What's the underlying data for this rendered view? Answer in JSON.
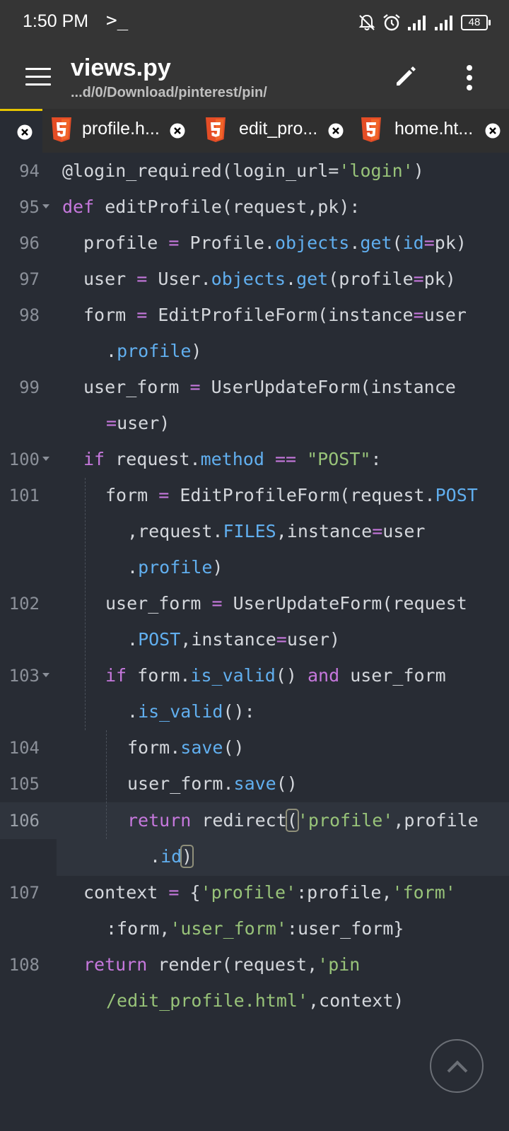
{
  "status_bar": {
    "time": "1:50 PM",
    "terminal_glyph": ">_",
    "battery": "48"
  },
  "app_bar": {
    "title": "views.py",
    "path": "...d/0/Download/pinterest/pin/"
  },
  "tabs": [
    {
      "label": "profile.h...",
      "active": false
    },
    {
      "label": "edit_pro...",
      "active": false
    },
    {
      "label": "home.ht...",
      "active": false
    }
  ],
  "editor": {
    "lines": [
      {
        "num": "94"
      },
      {
        "num": "95"
      },
      {
        "num": "96"
      },
      {
        "num": "97"
      },
      {
        "num": "98"
      },
      {
        "num": "99"
      },
      {
        "num": "100"
      },
      {
        "num": "101"
      },
      {
        "num": "102"
      },
      {
        "num": "103"
      },
      {
        "num": "104"
      },
      {
        "num": "105"
      },
      {
        "num": "106"
      },
      {
        "num": "107"
      },
      {
        "num": "108"
      }
    ],
    "code": {
      "l94_a": "@login_required(login_url=",
      "l94_b": "'login'",
      "l94_c": ")",
      "l95_def": "def",
      "l95_rest": " editProfile(request,pk):",
      "l96_a": "profile ",
      "l96_eq": "=",
      "l96_b": " Profile.",
      "l96_c": "objects",
      "l96_d": ".",
      "l96_e": "get",
      "l96_f": "(",
      "l96_g": "id",
      "l96_h": "=",
      "l96_i": "pk)",
      "l97_a": "user ",
      "l97_eq": "=",
      "l97_b": " User.",
      "l97_c": "objects",
      "l97_d": ".",
      "l97_e": "get",
      "l97_f": "(profile",
      "l97_g": "=",
      "l97_h": "pk)",
      "l98_a": "form ",
      "l98_eq": "=",
      "l98_b": " EditProfileForm(instance",
      "l98_c": "=",
      "l98_d": "user",
      "l98w_a": ".",
      "l98w_b": "profile",
      "l98w_c": ")",
      "l99_a": "user_form ",
      "l99_eq": "=",
      "l99_b": " UserUpdateForm(instance",
      "l99w_a": "=",
      "l99w_b": "user)",
      "l100_if": "if",
      "l100_a": " request.",
      "l100_b": "method",
      "l100_c": " ",
      "l100_d": "==",
      "l100_e": " ",
      "l100_f": "\"POST\"",
      "l100_g": ":",
      "l101_a": "form ",
      "l101_eq": "=",
      "l101_b": " EditProfileForm(request.",
      "l101_c": "POST",
      "l101w1_a": ",request.",
      "l101w1_b": "FILES",
      "l101w1_c": ",instance",
      "l101w1_d": "=",
      "l101w1_e": "user",
      "l101w2_a": ".",
      "l101w2_b": "profile",
      "l101w2_c": ")",
      "l102_a": "user_form ",
      "l102_eq": "=",
      "l102_b": " UserUpdateForm(request",
      "l102w_a": ".",
      "l102w_b": "POST",
      "l102w_c": ",instance",
      "l102w_d": "=",
      "l102w_e": "user)",
      "l103_if": "if",
      "l103_a": " form.",
      "l103_b": "is_valid",
      "l103_c": "() ",
      "l103_and": "and",
      "l103_d": " user_form",
      "l103w_a": ".",
      "l103w_b": "is_valid",
      "l103w_c": "():",
      "l104_a": "form.",
      "l104_b": "save",
      "l104_c": "()",
      "l105_a": "user_form.",
      "l105_b": "save",
      "l105_c": "()",
      "l106_ret": "return",
      "l106_a": " redirect",
      "l106_b": "(",
      "l106_c": "'profile'",
      "l106_d": ",profile",
      "l106w_a": ".",
      "l106w_b": "id",
      "l106w_c": ")",
      "l107_a": "context ",
      "l107_eq": "=",
      "l107_b": " {",
      "l107_c": "'profile'",
      "l107_d": ":profile,",
      "l107_e": "'form'",
      "l107w_a": ":form,",
      "l107w_b": "'user_form'",
      "l107w_c": ":user_form}",
      "l108_ret": "return",
      "l108_a": " render(request,",
      "l108_b": "'pin",
      "l108w_a": "/edit_profile.html'",
      "l108w_b": ",context)"
    }
  },
  "colors": {
    "background": "#282c34",
    "keyword": "#c678dd",
    "function": "#61afef",
    "string": "#98c379",
    "text": "#d4d7dc",
    "tab_accent": "#e6c400",
    "html5_orange": "#e44d26"
  },
  "icons": [
    "menu-icon",
    "pencil-icon",
    "more-vert-icon",
    "html5-icon",
    "close-circle-icon",
    "chevron-up-icon",
    "bell-off-icon",
    "alarm-icon",
    "signal-icon",
    "battery-icon"
  ]
}
